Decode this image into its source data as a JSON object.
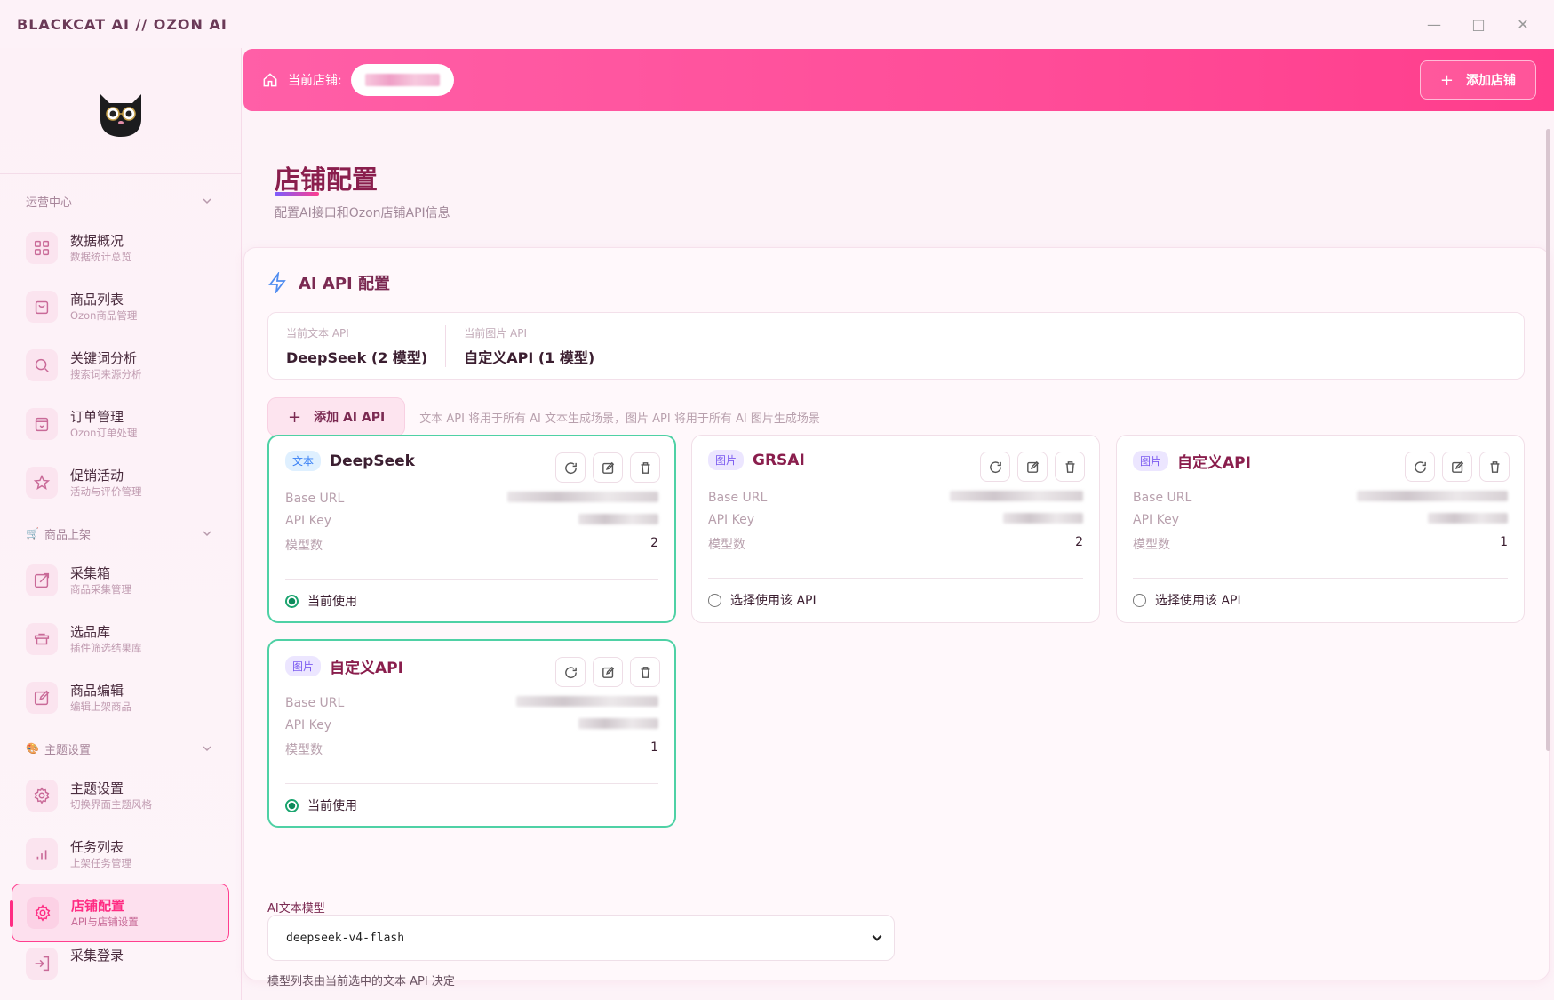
{
  "window": {
    "title": "BLACKCAT AI // OZON AI",
    "controls": [
      "—",
      "□",
      "✕"
    ]
  },
  "banner": {
    "store_label": "当前店铺:",
    "add_store_label": "添加店铺"
  },
  "sidebar": {
    "sections": [
      {
        "title": "运营中心",
        "items": [
          {
            "label": "数据概况",
            "sub": "数据统计总览",
            "icon": "grid-icon"
          },
          {
            "label": "商品列表",
            "sub": "Ozon商品管理",
            "icon": "bag-icon"
          },
          {
            "label": "关键词分析",
            "sub": "搜索词来源分析",
            "icon": "search-icon"
          },
          {
            "label": "订单管理",
            "sub": "Ozon订单处理",
            "icon": "store-icon"
          },
          {
            "label": "促销活动",
            "sub": "活动与评价管理",
            "icon": "star-icon"
          }
        ]
      },
      {
        "title": "商品上架",
        "items": [
          {
            "label": "采集箱",
            "sub": "商品采集管理",
            "icon": "external-link-icon"
          },
          {
            "label": "选品库",
            "sub": "插件筛选结果库",
            "icon": "box-icon"
          },
          {
            "label": "商品编辑",
            "sub": "编辑上架商品",
            "icon": "edit-icon"
          }
        ]
      },
      {
        "title": "主题设置",
        "items": [
          {
            "label": "主题设置",
            "sub": "切换界面主题风格",
            "icon": "gear-icon"
          },
          {
            "label": "任务列表",
            "sub": "上架任务管理",
            "icon": "bar-chart-icon"
          },
          {
            "label": "店铺配置",
            "sub": "API与店铺设置",
            "icon": "gear-icon",
            "active": true
          },
          {
            "label": "采集登录",
            "sub": "",
            "icon": "login-icon"
          }
        ]
      }
    ]
  },
  "page": {
    "title": "店铺配置",
    "subtitle": "配置AI接口和Ozon店铺API信息"
  },
  "ai_config": {
    "heading": "AI API 配置",
    "current_text_label": "当前文本 API",
    "current_text_value": "DeepSeek (2 模型)",
    "current_image_label": "当前图片 API",
    "current_image_value": "自定义API (1 模型)",
    "add_button": "添加 AI API",
    "hint": "文本 API 将用于所有 AI 文本生成场景，图片 API 将用于所有 AI 图片生成场景",
    "field_labels": {
      "base_url": "Base URL",
      "api_key": "API Key",
      "models": "模型数"
    },
    "cards": [
      {
        "tag": "文本",
        "tag_type": "text",
        "name": "DeepSeek",
        "models": "2",
        "status": "当前使用",
        "selected": true
      },
      {
        "tag": "图片",
        "tag_type": "img",
        "name": "GRSAI",
        "models": "2",
        "status": "选择使用该 API",
        "selected": false
      },
      {
        "tag": "图片",
        "tag_type": "img",
        "name": "自定义API",
        "models": "1",
        "status": "选择使用该 API",
        "selected": false
      },
      {
        "tag": "图片",
        "tag_type": "img",
        "name": "自定义API",
        "models": "1",
        "status": "当前使用",
        "selected": true
      }
    ],
    "model_label": "AI文本模型",
    "model_value": "deepseek-v4-flash",
    "model_note": "模型列表由当前选中的文本 API 决定"
  },
  "colors": {
    "accent": "#ff3d8e",
    "selected_border": "#4fd1a5",
    "title": "#8a1e4d"
  }
}
